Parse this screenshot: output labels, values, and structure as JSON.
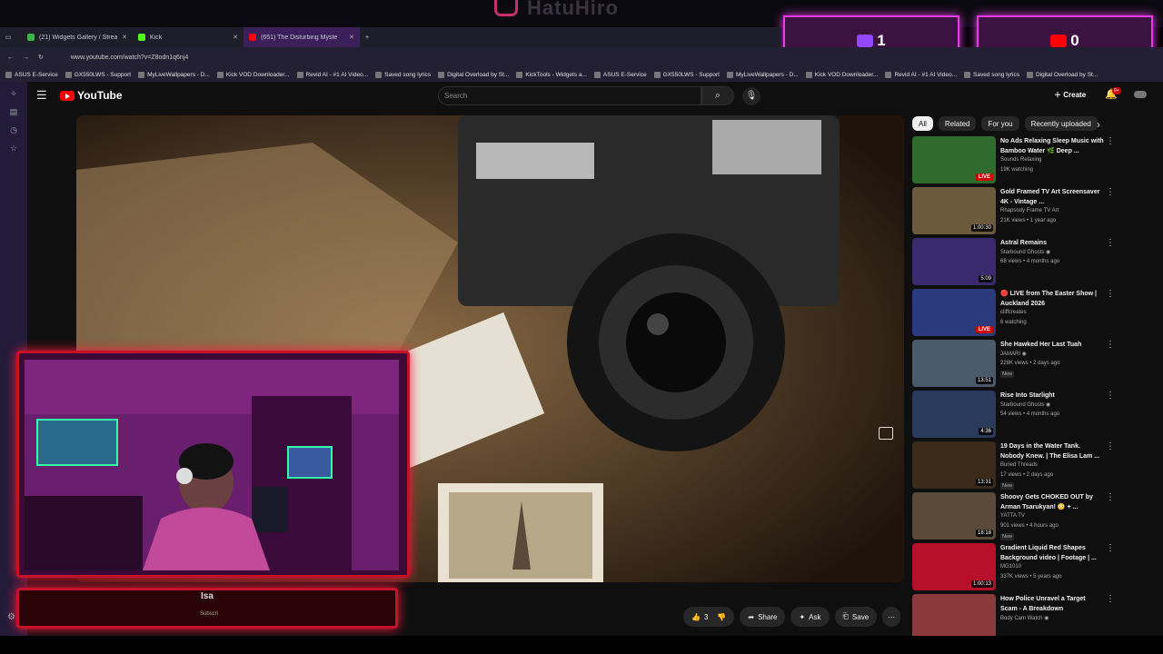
{
  "stream_overlay": {
    "instagram_name": "HatuHiro",
    "twitch_count": "1",
    "youtube_count": "0"
  },
  "browser": {
    "tabs": [
      {
        "label": "(21) Widgets Gallery / Streamlit",
        "active": false
      },
      {
        "label": "Kick",
        "active": false
      },
      {
        "label": "(651) The Disturbing Myste",
        "active": true
      }
    ],
    "new_tab": "+",
    "url": "www.youtube.com/watch?v=Z8odn1q6nj4",
    "bookmarks": [
      "ASUS E-Service",
      "GX550LWS - Support",
      "MyLiveWallpapers - D...",
      "Kick VOD Downloader...",
      "Revid AI - #1 AI Video...",
      "Saved song lyrics",
      "Digital Overload by St...",
      "KickTools - Widgets a...",
      "ASUS E-Service",
      "GX550LWS - Support",
      "MyLiveWallpapers - D...",
      "Kick VOD Downloader...",
      "Revid AI - #1 AI Video...",
      "Saved song lyrics",
      "Digital Overload by St..."
    ]
  },
  "youtube": {
    "logo": "YouTube",
    "search_placeholder": "Search",
    "create_label": "Create",
    "notif_badge": "9+",
    "actions": {
      "like_count": "3",
      "share": "Share",
      "ask": "Ask",
      "save": "Save"
    },
    "chips": [
      "All",
      "Related",
      "For you",
      "Recently uploaded"
    ],
    "recommendations": [
      {
        "title": "No Ads Relaxing Sleep Music with Bamboo Water 🌿 Deep ...",
        "channel": "Sounds Relaxing",
        "meta": "19K watching",
        "badge": "LIVE",
        "new": "",
        "color": "#2f6b2c"
      },
      {
        "title": "Gold Framed TV Art Screensaver 4K - Vintage ...",
        "channel": "Rhapsody Frame TV Art",
        "meta": "21K views • 1 year ago",
        "badge": "1:00:30",
        "new": "",
        "color": "#6b5a3c"
      },
      {
        "title": "Astral Remains",
        "channel": "Starbound Ghosts ◉",
        "meta": "68 views • 4 months ago",
        "badge": "5:09",
        "new": "",
        "color": "#3a2a6e"
      },
      {
        "title": "🔴 LIVE from The Easter Show | Auckland 2026",
        "channel": "cliffcreates",
        "meta": "6 watching",
        "badge": "LIVE",
        "new": "",
        "color": "#2a3a7a"
      },
      {
        "title": "She Hawked Her Last Tuah",
        "channel": "JAMARI ◉",
        "meta": "228K views • 2 days ago",
        "badge": "13:51",
        "new": "New",
        "color": "#4a5a6a"
      },
      {
        "title": "Rise Into Starlight",
        "channel": "Starbound Ghosts ◉",
        "meta": "54 views • 4 months ago",
        "badge": "4:36",
        "new": "",
        "color": "#2a3a5a"
      },
      {
        "title": "19 Days in the Water Tank. Nobody Knew. | The Elisa Lam ...",
        "channel": "Buried Threads",
        "meta": "17 views • 2 days ago",
        "badge": "13:31",
        "new": "New",
        "color": "#3a2a1a"
      },
      {
        "title": "Shoovy Gets CHOKED OUT by Arman Tsarukyan! 😳 + ...",
        "channel": "YATTA TV",
        "meta": "901 views • 4 hours ago",
        "badge": "18:18",
        "new": "New",
        "color": "#5a4a3a"
      },
      {
        "title": "Gradient Liquid Red Shapes Background video | Footage | ...",
        "channel": "MG1010",
        "meta": "337K views • 5 years ago",
        "badge": "1:00:13",
        "new": "",
        "color": "#b8102a"
      },
      {
        "title": "How Police Unravel a Target Scam - A Breakdown",
        "channel": "Body Cam Watch ◉",
        "meta": "",
        "badge": "",
        "new": "",
        "color": "#8a3a3a"
      }
    ]
  },
  "webcam": {
    "label": "Isa",
    "sub": "Subscri"
  },
  "colors": {
    "overlay_accent": "#e43de8",
    "cam_border": "#c5122a",
    "yt_red": "#ff0000"
  }
}
